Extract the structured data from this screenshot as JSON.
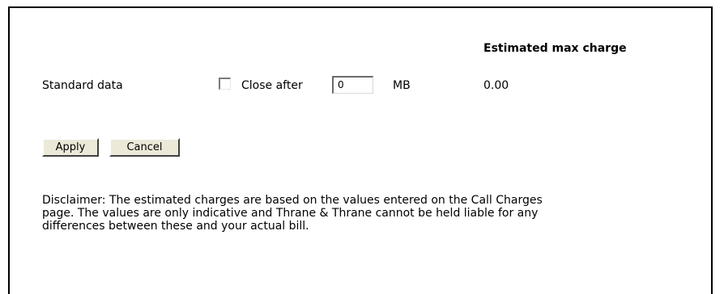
{
  "table": {
    "column_header": "Estimated max charge",
    "row": {
      "label": "Standard data",
      "checkbox_checked": false,
      "close_after_label": "Close after",
      "input_value": "0",
      "unit": "MB",
      "estimated_charge": "0.00"
    }
  },
  "buttons": {
    "apply_label": "Apply",
    "cancel_label": "Cancel"
  },
  "disclaimer": {
    "line1": "Disclaimer: The estimated charges are based on the values entered on the Call Charges",
    "line2": "page. The values are only indicative and Thrane & Thrane cannot be held liable for any",
    "line3": "differences between these and your actual bill."
  }
}
